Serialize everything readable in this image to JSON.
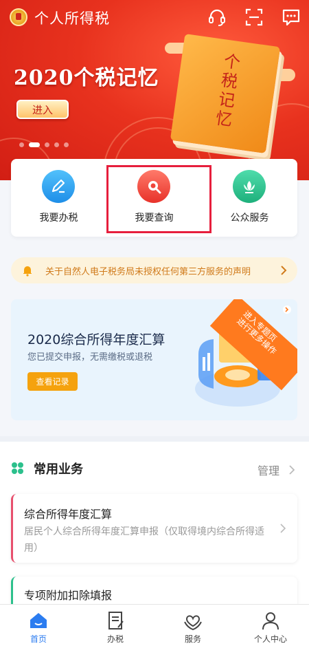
{
  "app": {
    "title": "个人所得税"
  },
  "top_icons": [
    "headset-icon",
    "scan-icon",
    "message-icon"
  ],
  "banner": {
    "title": "2020个税记忆",
    "enter_label": "进入",
    "book_text": "个税记忆",
    "slides": 5,
    "active_slide": 1
  },
  "quick_actions": [
    {
      "label": "我要办税",
      "icon": "edit-icon",
      "color": "#2a9ff0"
    },
    {
      "label": "我要查询",
      "icon": "search-icon",
      "color": "#f0453a"
    },
    {
      "label": "公众服务",
      "icon": "lotus-icon",
      "color": "#2cc08c"
    }
  ],
  "notice": {
    "text": "关于自然人电子税务局未授权任何第三方服务的声明",
    "icon": "bell-icon"
  },
  "annual_card": {
    "title": "2020综合所得年度汇算",
    "subtitle": "您已提交申报，无需缴税或退税",
    "button": "查看记录",
    "ribbon_line1": "进入专题页",
    "ribbon_line2": "进行更多操作"
  },
  "common": {
    "title": "常用业务",
    "manage": "管理",
    "items": [
      {
        "title": "综合所得年度汇算",
        "desc": "居民个人综合所得年度汇算申报（仅取得境内综合所得适用）"
      },
      {
        "title": "专项附加扣除填报",
        "desc": ""
      }
    ]
  },
  "tabs": [
    {
      "label": "首页",
      "icon": "home-icon",
      "active": true
    },
    {
      "label": "办税",
      "icon": "tax-form-icon",
      "active": false
    },
    {
      "label": "服务",
      "icon": "heart-hands-icon",
      "active": false
    },
    {
      "label": "个人中心",
      "icon": "person-icon",
      "active": false
    }
  ],
  "colors": {
    "accent": "#2b7cf0",
    "banner_red": "#e8321e",
    "warning_orange": "#f5a20e",
    "highlight_border": "#e61e3c"
  }
}
